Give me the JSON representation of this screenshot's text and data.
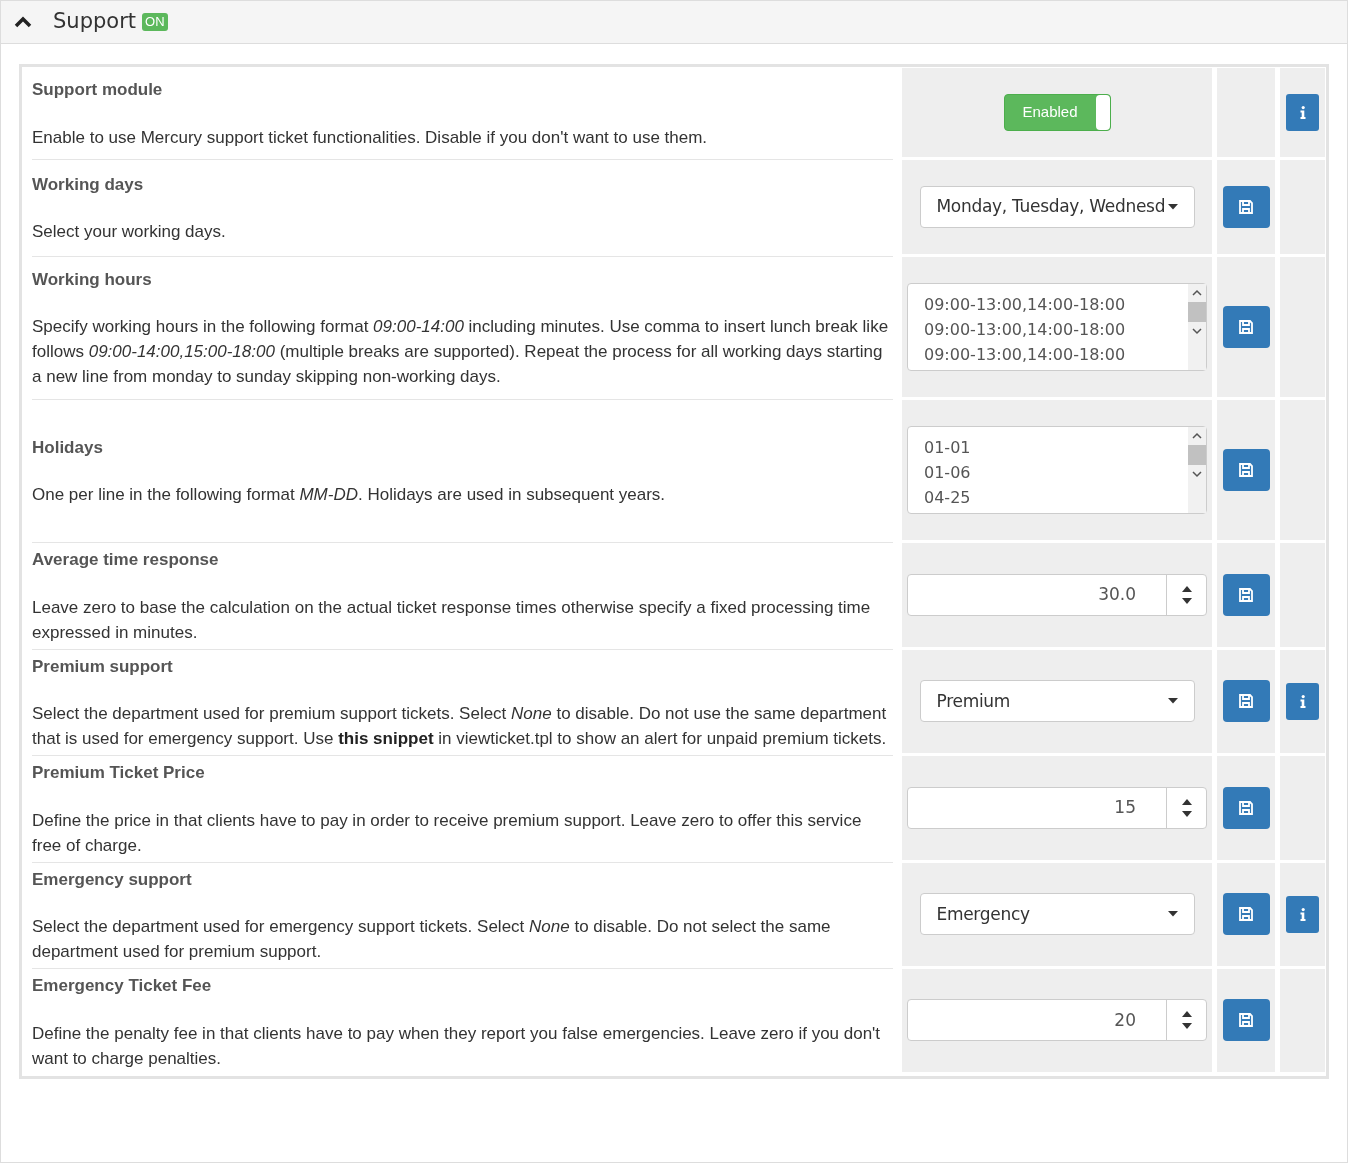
{
  "panel": {
    "title": "Support",
    "badge": "ON",
    "expanded": true
  },
  "settings": [
    {
      "title": "Support module",
      "description": "Enable to use Mercury support ticket functionalities. Disable if you don't want to use them.",
      "control": {
        "kind": "toggle",
        "on": true,
        "label": "Enabled"
      },
      "save": false,
      "info": true
    },
    {
      "title": "Working days",
      "description": "Select your working days.",
      "control": {
        "kind": "dropdown",
        "value": "Monday, Tuesday, Wednesd"
      },
      "save": true,
      "info": false
    },
    {
      "title": "Working hours",
      "description": "Specify working hours in the following format *09:00-14:00* including minutes. Use comma to insert lunch break like follows *09:00-14:00,15:00-18:00* (multiple breaks are supported). Repeat the process for all working days starting a new line from monday to sunday skipping non-working days.",
      "control": {
        "kind": "textarea",
        "lines": [
          "09:00-13:00,14:00-18:00",
          "09:00-13:00,14:00-18:00",
          "09:00-13:00,14:00-18:00"
        ]
      },
      "save": true,
      "info": false
    },
    {
      "title": "Holidays",
      "description": "One per line in the following format *MM-DD*. Holidays are used in subsequent years.",
      "control": {
        "kind": "textarea",
        "lines": [
          "01-01",
          "01-06",
          "04-25"
        ]
      },
      "save": true,
      "info": false
    },
    {
      "title": "Average time response",
      "description": "Leave zero to base the calculation on the actual ticket response times otherwise specify a fixed processing time expressed in minutes.",
      "control": {
        "kind": "number",
        "value": "30.0"
      },
      "save": true,
      "info": false
    },
    {
      "title": "Premium support",
      "description": "Select the department used for premium support tickets. Select *None* to disable. Do not use the same department that is used for emergency support. Use",
      "link": "this snippet",
      "description_end": "in viewticket.tpl to show an alert for unpaid premium tickets.",
      "control": {
        "kind": "select",
        "value": "Premium"
      },
      "save": true,
      "info": true
    },
    {
      "title": "Premium Ticket Price",
      "description": "Define the price in that clients have to pay in order to receive premium support. Leave zero to offer this service free of charge.",
      "control": {
        "kind": "number",
        "value": "15"
      },
      "save": true,
      "info": false
    },
    {
      "title": "Emergency support",
      "description": "Select the department used for emergency support tickets. Select *None* to disable. Do not select the same department used for premium support.",
      "control": {
        "kind": "select",
        "value": "Emergency"
      },
      "save": true,
      "info": true
    },
    {
      "title": "Emergency Ticket Fee",
      "description": "Define the penalty fee in that clients have to pay when they report you false emergencies. Leave zero if you don't want to charge penalties.",
      "control": {
        "kind": "number",
        "value": "20"
      },
      "save": true,
      "info": false
    }
  ]
}
